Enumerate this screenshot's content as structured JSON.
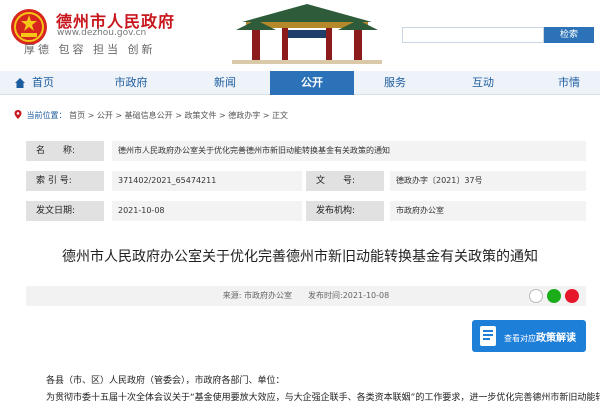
{
  "header": {
    "site_title": "德州市人民政府",
    "site_url": "www.dezhou.gov.cn",
    "slogan": "厚德 包容 担当 创新",
    "search_placeholder": "",
    "search_label": "检索"
  },
  "nav": {
    "items": [
      {
        "label": "首页"
      },
      {
        "label": "市政府"
      },
      {
        "label": "新闻"
      },
      {
        "label": "公开"
      },
      {
        "label": "服务"
      },
      {
        "label": "互动"
      },
      {
        "label": "市情"
      }
    ],
    "active_index": 3
  },
  "breadcrumb": {
    "location_label": "当前位置：",
    "path": "首页 > 公开 > 基础信息公开 > 政策文件 > 德政办字 > 正文"
  },
  "info_table": {
    "name_label": "名　　称:",
    "name_value": "德州市人民政府办公室关于优化完善德州市新旧动能转换基金有关政策的通知",
    "index_label": "索 引 号:",
    "index_value": "371402/2021_65474211",
    "doc_label": "文　　号:",
    "doc_value": "德政办字〔2021〕37号",
    "date_label": "发文日期:",
    "date_value": "2021-10-08",
    "org_label": "发布机构:",
    "org_value": "市政府办公室"
  },
  "article": {
    "title": "德州市人民政府办公室关于优化完善德州市新旧动能转换基金有关政策的通知",
    "meta": "来源: 市政府办公室　　发布时间:2021-10-08",
    "policy_button_prefix": "查看对应",
    "policy_button_emph": "政策解读",
    "paragraph1": "各县（市、区）人民政府（管委会），市政府各部门、单位：",
    "paragraph2": "为贯彻市委十五届十次全体会议关于“基金使用要放大效应，与大企强企联手、各类资本联姻”的工作要求，进一步优化完善德州市新旧动能转换基金有关政策"
  },
  "colors": {
    "brand_red": "#c8161d",
    "nav_blue": "#2b72b8",
    "link_blue": "#1d5c9e"
  }
}
